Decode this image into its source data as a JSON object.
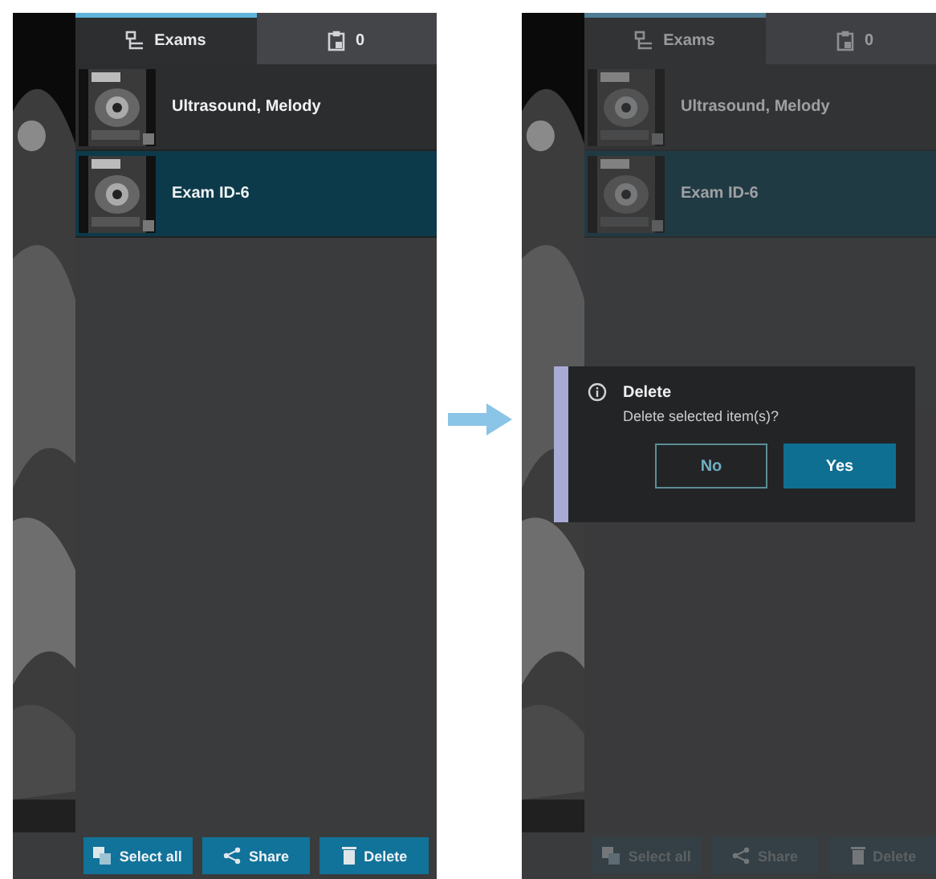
{
  "screens": [
    {
      "dimmed": false,
      "tabs": [
        {
          "label": "Exams",
          "selected": true
        },
        {
          "label": "0",
          "selected": false
        }
      ],
      "exams": [
        {
          "kind": "picture",
          "title": "Ultrasound, Melody",
          "selected": false
        },
        {
          "kind": "picture",
          "title": "Exam ID-6",
          "selected": true
        }
      ],
      "actions": [
        {
          "label": "Select all",
          "disabled": false
        },
        {
          "label": "Share",
          "disabled": false
        },
        {
          "label": "Delete",
          "disabled": false
        }
      ]
    },
    {
      "dimmed": true,
      "tabs": [
        {
          "label": "Exams",
          "selected": true
        },
        {
          "label": "0",
          "selected": false
        }
      ],
      "exams": [
        {
          "kind": "picture",
          "title": "Ultrasound, Melody",
          "selected": false
        },
        {
          "kind": "picture",
          "title": "Exam ID-6",
          "selected": true
        }
      ],
      "actions": [
        {
          "label": "Select all",
          "disabled": true
        },
        {
          "label": "Share",
          "disabled": true
        },
        {
          "label": "Delete",
          "disabled": true
        }
      ],
      "dialog": {
        "title": "Delete",
        "message": "Delete selected item(s)?",
        "buttons": [
          {
            "label": "No",
            "kind": "secondary"
          },
          {
            "label": "Yes",
            "kind": "primary"
          }
        ]
      }
    }
  ]
}
